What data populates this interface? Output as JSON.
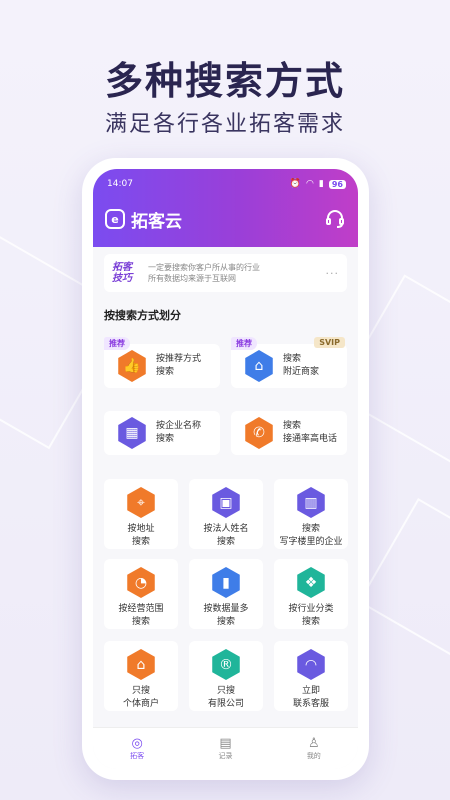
{
  "promo": {
    "headline": "多种搜索方式",
    "subline": "满足各行各业拓客需求"
  },
  "status": {
    "time": "14:07",
    "battery": "96"
  },
  "app": {
    "name": "拓客云",
    "logo_letter": "e"
  },
  "tips": {
    "badge_line1": "拓客",
    "badge_line2": "技巧",
    "line1": "一定要搜索你客户所从事的行业",
    "line2": "所有数据均来源于互联网",
    "more": "···"
  },
  "section_title": "按搜索方式划分",
  "cards": [
    {
      "line1": "按推荐方式",
      "line2": "搜索",
      "tag": "推荐",
      "color": "#f07a2a",
      "icon": "thumbs-up-icon",
      "glyph": "👍"
    },
    {
      "line1": "搜索",
      "line2": "附近商家",
      "tag": "推荐",
      "color": "#3f7de8",
      "icon": "store-icon",
      "glyph": "⌂"
    },
    {
      "line1": "按企业名称",
      "line2": "搜索",
      "color": "#6a5ae0",
      "icon": "building-icon",
      "glyph": "▦"
    },
    {
      "line1": "搜索",
      "line2": "接通率高电话",
      "color": "#f07a2a",
      "icon": "phone-icon",
      "glyph": "✆"
    },
    {
      "line1": "按地址",
      "line2": "搜索",
      "color": "#f07a2a",
      "icon": "location-pin-icon",
      "glyph": "⌖"
    },
    {
      "line1": "按法人姓名",
      "line2": "搜索",
      "color": "#6a5ae0",
      "icon": "id-card-icon",
      "glyph": "▣"
    },
    {
      "line1": "搜索",
      "line2": "写字楼里的企业",
      "color": "#6a5ae0",
      "icon": "office-building-icon",
      "glyph": "▥"
    },
    {
      "line1": "按经营范围",
      "line2": "搜索",
      "color": "#f07a2a",
      "icon": "pie-chart-icon",
      "glyph": "◔"
    },
    {
      "line1": "按数据量多",
      "line2": "搜索",
      "color": "#3f7de8",
      "icon": "bar-chart-icon",
      "glyph": "▮"
    },
    {
      "line1": "按行业分类",
      "line2": "搜索",
      "color": "#20b59a",
      "icon": "category-icon",
      "glyph": "❖"
    },
    {
      "line1": "只搜",
      "line2": "个体商户",
      "color": "#f07a2a",
      "icon": "shop-icon",
      "glyph": "⌂"
    },
    {
      "line1": "只搜",
      "line2": "有限公司",
      "color": "#20b59a",
      "icon": "registered-icon",
      "glyph": "®"
    },
    {
      "line1": "立即",
      "line2": "联系客服",
      "color": "#6a5ae0",
      "icon": "chat-icon",
      "glyph": "◠"
    }
  ],
  "svip_label": "SVIP",
  "nav": [
    {
      "label": "拓客",
      "icon": "radar-icon",
      "glyph": "◎",
      "active": true
    },
    {
      "label": "记录",
      "icon": "clipboard-icon",
      "glyph": "▤",
      "active": false
    },
    {
      "label": "我的",
      "icon": "user-icon",
      "glyph": "♙",
      "active": false
    }
  ],
  "colors": {
    "accent": "#7b4cf0",
    "accent_end": "#c03ec8",
    "orange": "#f07a2a",
    "blue": "#3f7de8",
    "teal": "#20b59a"
  }
}
